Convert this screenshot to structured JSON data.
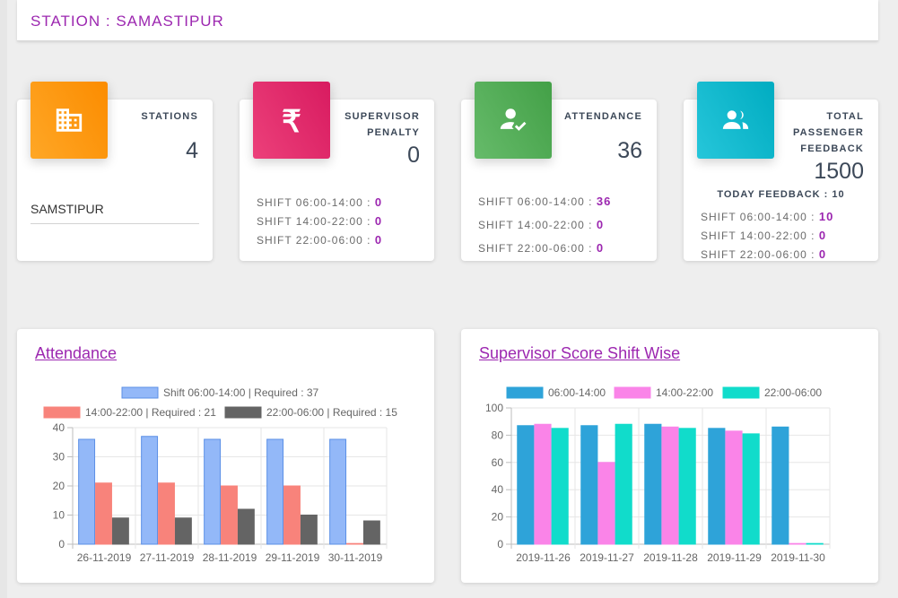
{
  "header": {
    "title": "STATION : SAMASTIPUR"
  },
  "cards": {
    "stations": {
      "label": "STATIONS",
      "value": "4",
      "station_name": "SAMSTIPUR",
      "icon": "building-icon",
      "color": "#fb8c00"
    },
    "penalty": {
      "label_line1": "SUPERVISOR",
      "label_line2": "PENALTY",
      "value": "0",
      "icon": "rupee-icon",
      "color": "#d81b60",
      "shifts": [
        {
          "label": "SHIFT 06:00-14:00 :",
          "value": "0"
        },
        {
          "label": "SHIFT 14:00-22:00 :",
          "value": "0"
        },
        {
          "label": "SHIFT 22:00-06:00 :",
          "value": "0"
        }
      ]
    },
    "attendance": {
      "label": "ATTENDANCE",
      "value": "36",
      "icon": "user-check-icon",
      "color": "#43a047",
      "shifts": [
        {
          "label": "SHIFT 06:00-14:00 :",
          "value": "36"
        },
        {
          "label": "SHIFT 14:00-22:00 :",
          "value": "0"
        },
        {
          "label": "SHIFT 22:00-06:00 :",
          "value": "0"
        }
      ]
    },
    "feedback": {
      "label_line1": "TOTAL",
      "label_line2": "PASSENGER",
      "label_line3": "FEEDBACK",
      "value": "1500",
      "icon": "users-icon",
      "color": "#00acc1",
      "today": "TODAY FEEDBACK : 10",
      "shifts": [
        {
          "label": "SHIFT 06:00-14:00 :",
          "value": "10"
        },
        {
          "label": "SHIFT 14:00-22:00 :",
          "value": "0"
        },
        {
          "label": "SHIFT 22:00-06:00 :",
          "value": "0"
        }
      ]
    }
  },
  "chart_data": [
    {
      "type": "bar",
      "title": "Attendance",
      "categories": [
        "26-11-2019",
        "27-11-2019",
        "28-11-2019",
        "29-11-2019",
        "30-11-2019"
      ],
      "ylim": [
        0,
        40
      ],
      "yticks": [
        0,
        10,
        20,
        30,
        40
      ],
      "legend_placement": "top",
      "grid": true,
      "series": [
        {
          "name": "Shift 06:00-14:00 | Required : 37",
          "color": "#93b8f8",
          "border": "#5b8fe6",
          "values": [
            36,
            37,
            36,
            36,
            36
          ]
        },
        {
          "name": "14:00-22:00 | Required : 21",
          "color": "#f8837b",
          "border": "#f8837b",
          "values": [
            21,
            21,
            20,
            20,
            0
          ]
        },
        {
          "name": "22:00-06:00 | Required : 15",
          "color": "#646464",
          "border": "#646464",
          "values": [
            9,
            9,
            12,
            10,
            8
          ]
        }
      ]
    },
    {
      "type": "bar",
      "title": "Supervisor Score Shift Wise",
      "categories": [
        "2019-11-26",
        "2019-11-27",
        "2019-11-28",
        "2019-11-29",
        "2019-11-30"
      ],
      "ylim": [
        0,
        100
      ],
      "yticks": [
        0,
        20,
        40,
        60,
        80,
        100
      ],
      "legend_placement": "top",
      "grid": true,
      "series": [
        {
          "name": "06:00-14:00",
          "color": "#2ea3d9",
          "border": "#2ea3d9",
          "values": [
            87,
            87,
            88,
            85,
            86
          ]
        },
        {
          "name": "14:00-22:00",
          "color": "#fa84e8",
          "border": "#fa84e8",
          "values": [
            88,
            60,
            86,
            83,
            0
          ]
        },
        {
          "name": "22:00-06:00",
          "color": "#11dccb",
          "border": "#11dccb",
          "values": [
            85,
            88,
            85,
            81,
            0
          ]
        }
      ]
    }
  ]
}
